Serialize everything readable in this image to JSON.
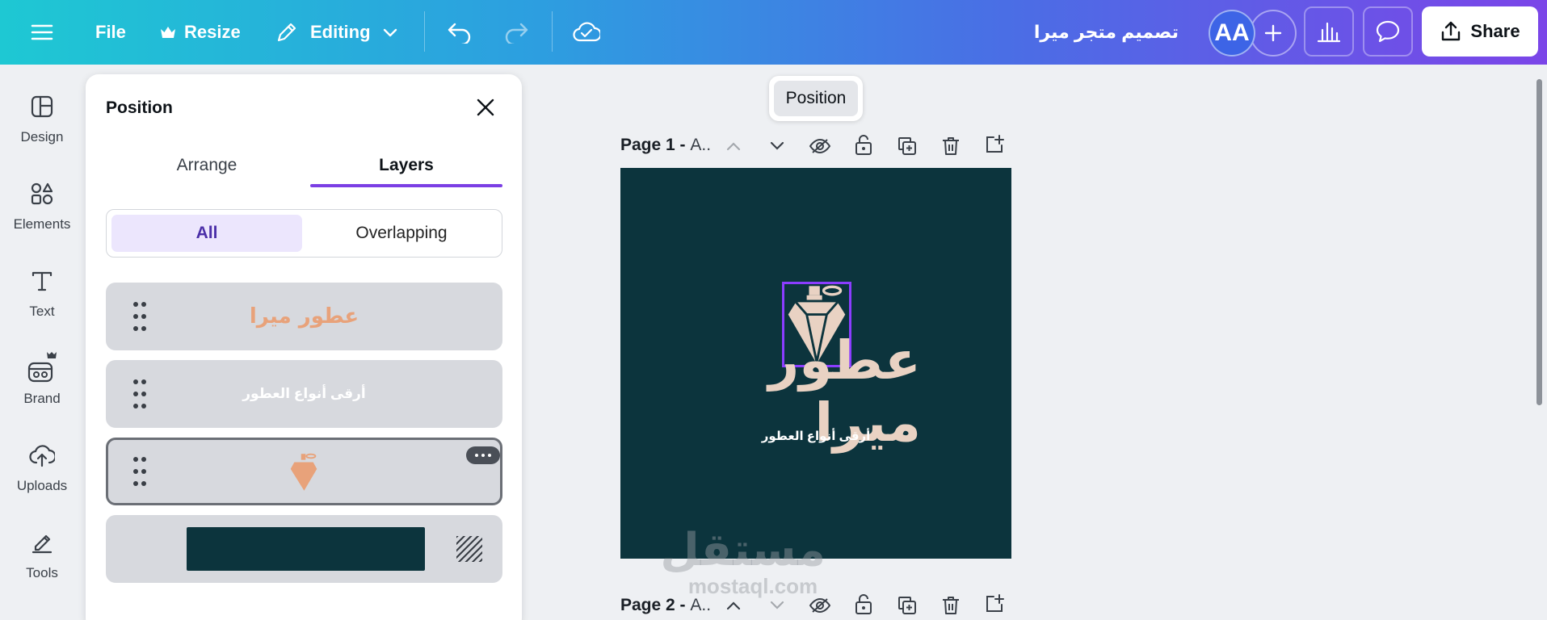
{
  "topbar": {
    "file_label": "File",
    "resize_label": "Resize",
    "editing_label": "Editing",
    "doc_title": "تصميم متجر ميرا",
    "avatar_initials": "AA",
    "share_label": "Share",
    "icons": [
      "menu-icon",
      "crown-icon",
      "pencil-icon",
      "chevron-down-icon",
      "undo-icon",
      "redo-icon",
      "cloud-check-icon",
      "plus-icon",
      "chart-icon",
      "comment-icon",
      "share-icon"
    ]
  },
  "sidebar": {
    "items": [
      {
        "label": "Design",
        "icon": "design-icon"
      },
      {
        "label": "Elements",
        "icon": "elements-icon"
      },
      {
        "label": "Text",
        "icon": "text-icon"
      },
      {
        "label": "Brand",
        "icon": "brand-icon"
      },
      {
        "label": "Uploads",
        "icon": "uploads-icon"
      },
      {
        "label": "Tools",
        "icon": "tools-icon"
      }
    ]
  },
  "panel": {
    "title": "Position",
    "tabs": [
      "Arrange",
      "Layers"
    ],
    "active_tab": "Layers",
    "filters": [
      "All",
      "Overlapping"
    ],
    "active_filter": "All",
    "layers": [
      {
        "type": "text",
        "text": "عطور ميرا",
        "color": "#e8a27a"
      },
      {
        "type": "text",
        "text": "أرقى أنواع العطور",
        "color": "#ffffff"
      },
      {
        "type": "graphic",
        "icon": "perfume-bottle-icon",
        "selected": true
      },
      {
        "type": "background",
        "color": "#0c343d"
      }
    ]
  },
  "canvas": {
    "tooltip": "Position",
    "pages": [
      {
        "label": "Page 1 - ",
        "suffix": "A.."
      },
      {
        "label": "Page 2 - ",
        "suffix": "A.."
      }
    ],
    "page_background": "#0c343d",
    "logo_text": "عطور ميرا",
    "tagline": "أرقى أنواع العطور",
    "logo_color": "#e9d2c3",
    "selection_color": "#8b3dff"
  },
  "watermark": {
    "arabic": "مستقل",
    "latin": "mostaql.com"
  }
}
